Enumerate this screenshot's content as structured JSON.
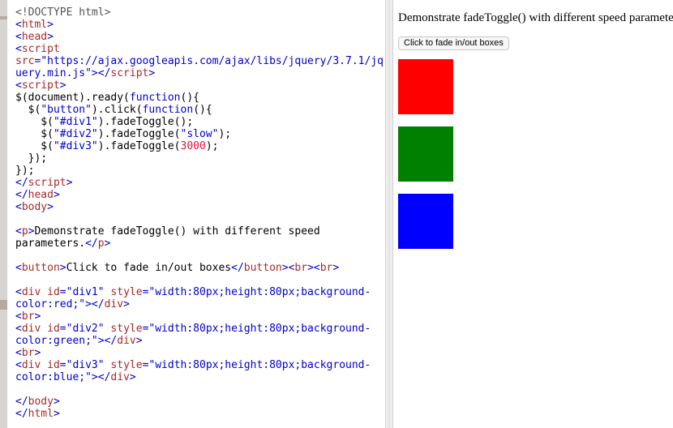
{
  "code_lines": [
    [
      {
        "c": "t-doctype",
        "t": "<!DOCTYPE html>"
      }
    ],
    [
      {
        "c": "t-punct",
        "t": "<"
      },
      {
        "c": "t-tag",
        "t": "html"
      },
      {
        "c": "t-punct",
        "t": ">"
      }
    ],
    [
      {
        "c": "t-punct",
        "t": "<"
      },
      {
        "c": "t-tag",
        "t": "head"
      },
      {
        "c": "t-punct",
        "t": ">"
      }
    ],
    [
      {
        "c": "t-punct",
        "t": "<"
      },
      {
        "c": "t-tag",
        "t": "script"
      }
    ],
    [
      {
        "c": "t-attr",
        "t": "src"
      },
      {
        "c": "t-punct",
        "t": "="
      },
      {
        "c": "t-str",
        "t": "\"https://ajax.googleapis.com/ajax/libs/jquery/3.7.1/jq"
      }
    ],
    [
      {
        "c": "t-str",
        "t": "uery.min.js\""
      },
      {
        "c": "t-punct",
        "t": "></"
      },
      {
        "c": "t-tag",
        "t": "script"
      },
      {
        "c": "t-punct",
        "t": ">"
      }
    ],
    [
      {
        "c": "t-punct",
        "t": "<"
      },
      {
        "c": "t-tag",
        "t": "script"
      },
      {
        "c": "t-punct",
        "t": ">"
      }
    ],
    [
      {
        "c": "t-text",
        "t": "$(document).ready("
      },
      {
        "c": "t-kw",
        "t": "function"
      },
      {
        "c": "t-text",
        "t": "(){"
      }
    ],
    [
      {
        "c": "t-text",
        "t": "  $("
      },
      {
        "c": "t-str",
        "t": "\"button\""
      },
      {
        "c": "t-text",
        "t": ").click("
      },
      {
        "c": "t-kw",
        "t": "function"
      },
      {
        "c": "t-text",
        "t": "(){"
      }
    ],
    [
      {
        "c": "t-text",
        "t": "    $("
      },
      {
        "c": "t-str",
        "t": "\"#div1\""
      },
      {
        "c": "t-text",
        "t": ").fadeToggle();"
      }
    ],
    [
      {
        "c": "t-text",
        "t": "    $("
      },
      {
        "c": "t-str",
        "t": "\"#div2\""
      },
      {
        "c": "t-text",
        "t": ").fadeToggle("
      },
      {
        "c": "t-str",
        "t": "\"slow\""
      },
      {
        "c": "t-text",
        "t": ");"
      }
    ],
    [
      {
        "c": "t-text",
        "t": "    $("
      },
      {
        "c": "t-str",
        "t": "\"#div3\""
      },
      {
        "c": "t-text",
        "t": ").fadeToggle("
      },
      {
        "c": "t-num",
        "t": "3000"
      },
      {
        "c": "t-text",
        "t": ");"
      }
    ],
    [
      {
        "c": "t-text",
        "t": "  });"
      }
    ],
    [
      {
        "c": "t-text",
        "t": "});"
      }
    ],
    [
      {
        "c": "t-punct",
        "t": "</"
      },
      {
        "c": "t-tag",
        "t": "script"
      },
      {
        "c": "t-punct",
        "t": ">"
      }
    ],
    [
      {
        "c": "t-punct",
        "t": "</"
      },
      {
        "c": "t-tag",
        "t": "head"
      },
      {
        "c": "t-punct",
        "t": ">"
      }
    ],
    [
      {
        "c": "t-punct",
        "t": "<"
      },
      {
        "c": "t-tag",
        "t": "body"
      },
      {
        "c": "t-punct",
        "t": ">"
      }
    ],
    [],
    [
      {
        "c": "t-punct",
        "t": "<"
      },
      {
        "c": "t-tag",
        "t": "p"
      },
      {
        "c": "t-punct",
        "t": ">"
      },
      {
        "c": "t-text",
        "t": "Demonstrate fadeToggle() with different speed"
      }
    ],
    [
      {
        "c": "t-text",
        "t": "parameters."
      },
      {
        "c": "t-punct",
        "t": "</"
      },
      {
        "c": "t-tag",
        "t": "p"
      },
      {
        "c": "t-punct",
        "t": ">"
      }
    ],
    [],
    [
      {
        "c": "t-punct",
        "t": "<"
      },
      {
        "c": "t-tag",
        "t": "button"
      },
      {
        "c": "t-punct",
        "t": ">"
      },
      {
        "c": "t-text",
        "t": "Click to fade in/out boxes"
      },
      {
        "c": "t-punct",
        "t": "</"
      },
      {
        "c": "t-tag",
        "t": "button"
      },
      {
        "c": "t-punct",
        "t": "><"
      },
      {
        "c": "t-tag",
        "t": "br"
      },
      {
        "c": "t-punct",
        "t": "><"
      },
      {
        "c": "t-tag",
        "t": "br"
      },
      {
        "c": "t-punct",
        "t": ">"
      }
    ],
    [],
    [
      {
        "c": "t-punct",
        "t": "<"
      },
      {
        "c": "t-tag",
        "t": "div"
      },
      {
        "c": "t-text",
        "t": " "
      },
      {
        "c": "t-attr",
        "t": "id"
      },
      {
        "c": "t-punct",
        "t": "="
      },
      {
        "c": "t-str",
        "t": "\"div1\""
      },
      {
        "c": "t-text",
        "t": " "
      },
      {
        "c": "t-attr",
        "t": "style"
      },
      {
        "c": "t-punct",
        "t": "="
      },
      {
        "c": "t-str",
        "t": "\"width:80px;height:80px;background-"
      }
    ],
    [
      {
        "c": "t-str",
        "t": "color:red;\""
      },
      {
        "c": "t-punct",
        "t": "></"
      },
      {
        "c": "t-tag",
        "t": "div"
      },
      {
        "c": "t-punct",
        "t": ">"
      }
    ],
    [
      {
        "c": "t-punct",
        "t": "<"
      },
      {
        "c": "t-tag",
        "t": "br"
      },
      {
        "c": "t-punct",
        "t": ">"
      }
    ],
    [
      {
        "c": "t-punct",
        "t": "<"
      },
      {
        "c": "t-tag",
        "t": "div"
      },
      {
        "c": "t-text",
        "t": " "
      },
      {
        "c": "t-attr",
        "t": "id"
      },
      {
        "c": "t-punct",
        "t": "="
      },
      {
        "c": "t-str",
        "t": "\"div2\""
      },
      {
        "c": "t-text",
        "t": " "
      },
      {
        "c": "t-attr",
        "t": "style"
      },
      {
        "c": "t-punct",
        "t": "="
      },
      {
        "c": "t-str",
        "t": "\"width:80px;height:80px;background-"
      }
    ],
    [
      {
        "c": "t-str",
        "t": "color:green;\""
      },
      {
        "c": "t-punct",
        "t": "></"
      },
      {
        "c": "t-tag",
        "t": "div"
      },
      {
        "c": "t-punct",
        "t": ">"
      }
    ],
    [
      {
        "c": "t-punct",
        "t": "<"
      },
      {
        "c": "t-tag",
        "t": "br"
      },
      {
        "c": "t-punct",
        "t": ">"
      }
    ],
    [
      {
        "c": "t-punct",
        "t": "<"
      },
      {
        "c": "t-tag",
        "t": "div"
      },
      {
        "c": "t-text",
        "t": " "
      },
      {
        "c": "t-attr",
        "t": "id"
      },
      {
        "c": "t-punct",
        "t": "="
      },
      {
        "c": "t-str",
        "t": "\"div3\""
      },
      {
        "c": "t-text",
        "t": " "
      },
      {
        "c": "t-attr",
        "t": "style"
      },
      {
        "c": "t-punct",
        "t": "="
      },
      {
        "c": "t-str",
        "t": "\"width:80px;height:80px;background-"
      }
    ],
    [
      {
        "c": "t-str",
        "t": "color:blue;\""
      },
      {
        "c": "t-punct",
        "t": "></"
      },
      {
        "c": "t-tag",
        "t": "div"
      },
      {
        "c": "t-punct",
        "t": ">"
      }
    ],
    [],
    [
      {
        "c": "t-punct",
        "t": "</"
      },
      {
        "c": "t-tag",
        "t": "body"
      },
      {
        "c": "t-punct",
        "t": ">"
      }
    ],
    [
      {
        "c": "t-punct",
        "t": "</"
      },
      {
        "c": "t-tag",
        "t": "html"
      },
      {
        "c": "t-punct",
        "t": ">"
      }
    ]
  ],
  "result": {
    "paragraph": "Demonstrate fadeToggle() with different speed parameters.",
    "button_label": "Click to fade in/out boxes",
    "boxes": [
      {
        "id": "div1",
        "color": "#ff0000"
      },
      {
        "id": "div2",
        "color": "#008000"
      },
      {
        "id": "div3",
        "color": "#0000ff"
      }
    ]
  },
  "colors": {
    "tag": "#a52a2a",
    "string": "#0000cd",
    "keyword": "#0000cd",
    "number": "#dc143c"
  }
}
